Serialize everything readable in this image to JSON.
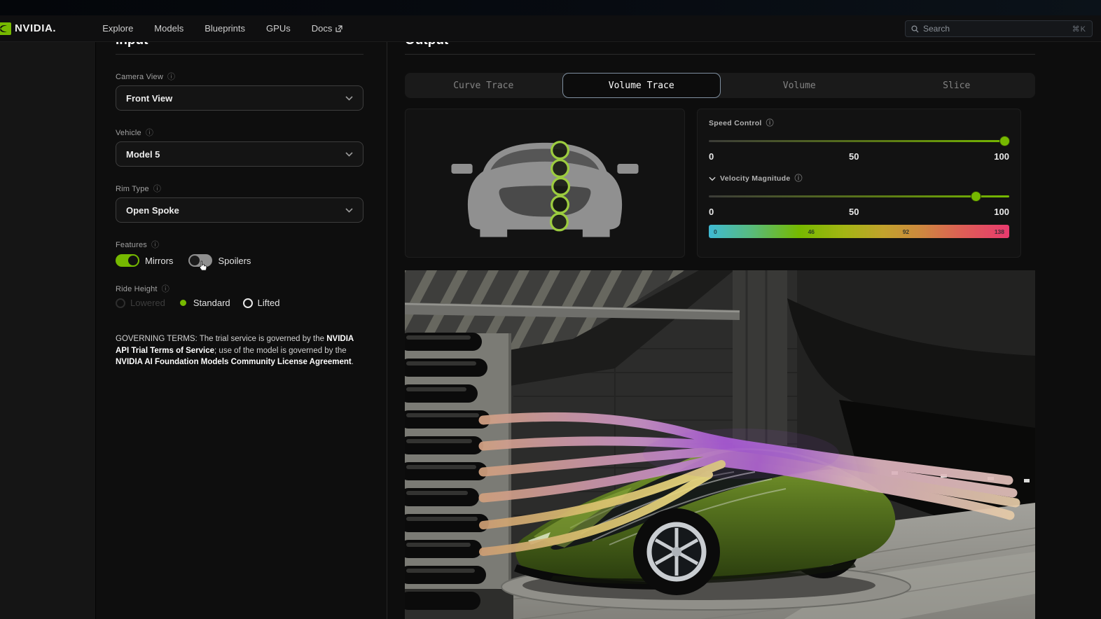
{
  "nav": {
    "brand": "NVIDIA.",
    "links": [
      "Explore",
      "Models",
      "Blueprints",
      "GPUs",
      "Docs"
    ],
    "search_placeholder": "Search",
    "search_shortcut": "⌘K"
  },
  "input_panel": {
    "title": "Input",
    "camera_view": {
      "label": "Camera View",
      "value": "Front View"
    },
    "vehicle": {
      "label": "Vehicle",
      "value": "Model 5"
    },
    "rim_type": {
      "label": "Rim Type",
      "value": "Open Spoke"
    },
    "features": {
      "label": "Features",
      "mirrors": {
        "label": "Mirrors",
        "on": true
      },
      "spoilers": {
        "label": "Spoilers",
        "on": false
      }
    },
    "ride_height": {
      "label": "Ride Height",
      "options": [
        {
          "label": "Lowered",
          "state": "disabled"
        },
        {
          "label": "Standard",
          "state": "selected"
        },
        {
          "label": "Lifted",
          "state": "unselected"
        }
      ]
    },
    "governing_terms": {
      "prefix": "GOVERNING TERMS: The trial service is governed by the ",
      "link1": "NVIDIA API Trial Terms of Service",
      "middle": "; use of the model is governed by the ",
      "link2": "NVIDIA AI Foundation Models Community License Agreement",
      "suffix": "."
    }
  },
  "output_panel": {
    "title": "Output",
    "tabs": [
      {
        "label": "Curve Trace",
        "active": false
      },
      {
        "label": "Volume Trace",
        "active": true
      },
      {
        "label": "Volume",
        "active": false
      },
      {
        "label": "Slice",
        "active": false
      }
    ],
    "speed_control": {
      "label": "Speed Control",
      "ticks": [
        "0",
        "50",
        "100"
      ],
      "value_percent": 100
    },
    "velocity_magnitude": {
      "label": "Velocity Magnitude",
      "ticks": [
        "0",
        "50",
        "100"
      ],
      "value_percent": 89,
      "colorbar_labels": [
        "0",
        "46",
        "92",
        "138"
      ]
    },
    "trace_probe_count": 5
  },
  "colors": {
    "nvidia_green": "#76b900",
    "tab_active_border": "#7f8fa0",
    "colorbar_gradient": [
      "#3fb9d3",
      "#76b900",
      "#cd8a3e",
      "#e83a6e"
    ]
  }
}
